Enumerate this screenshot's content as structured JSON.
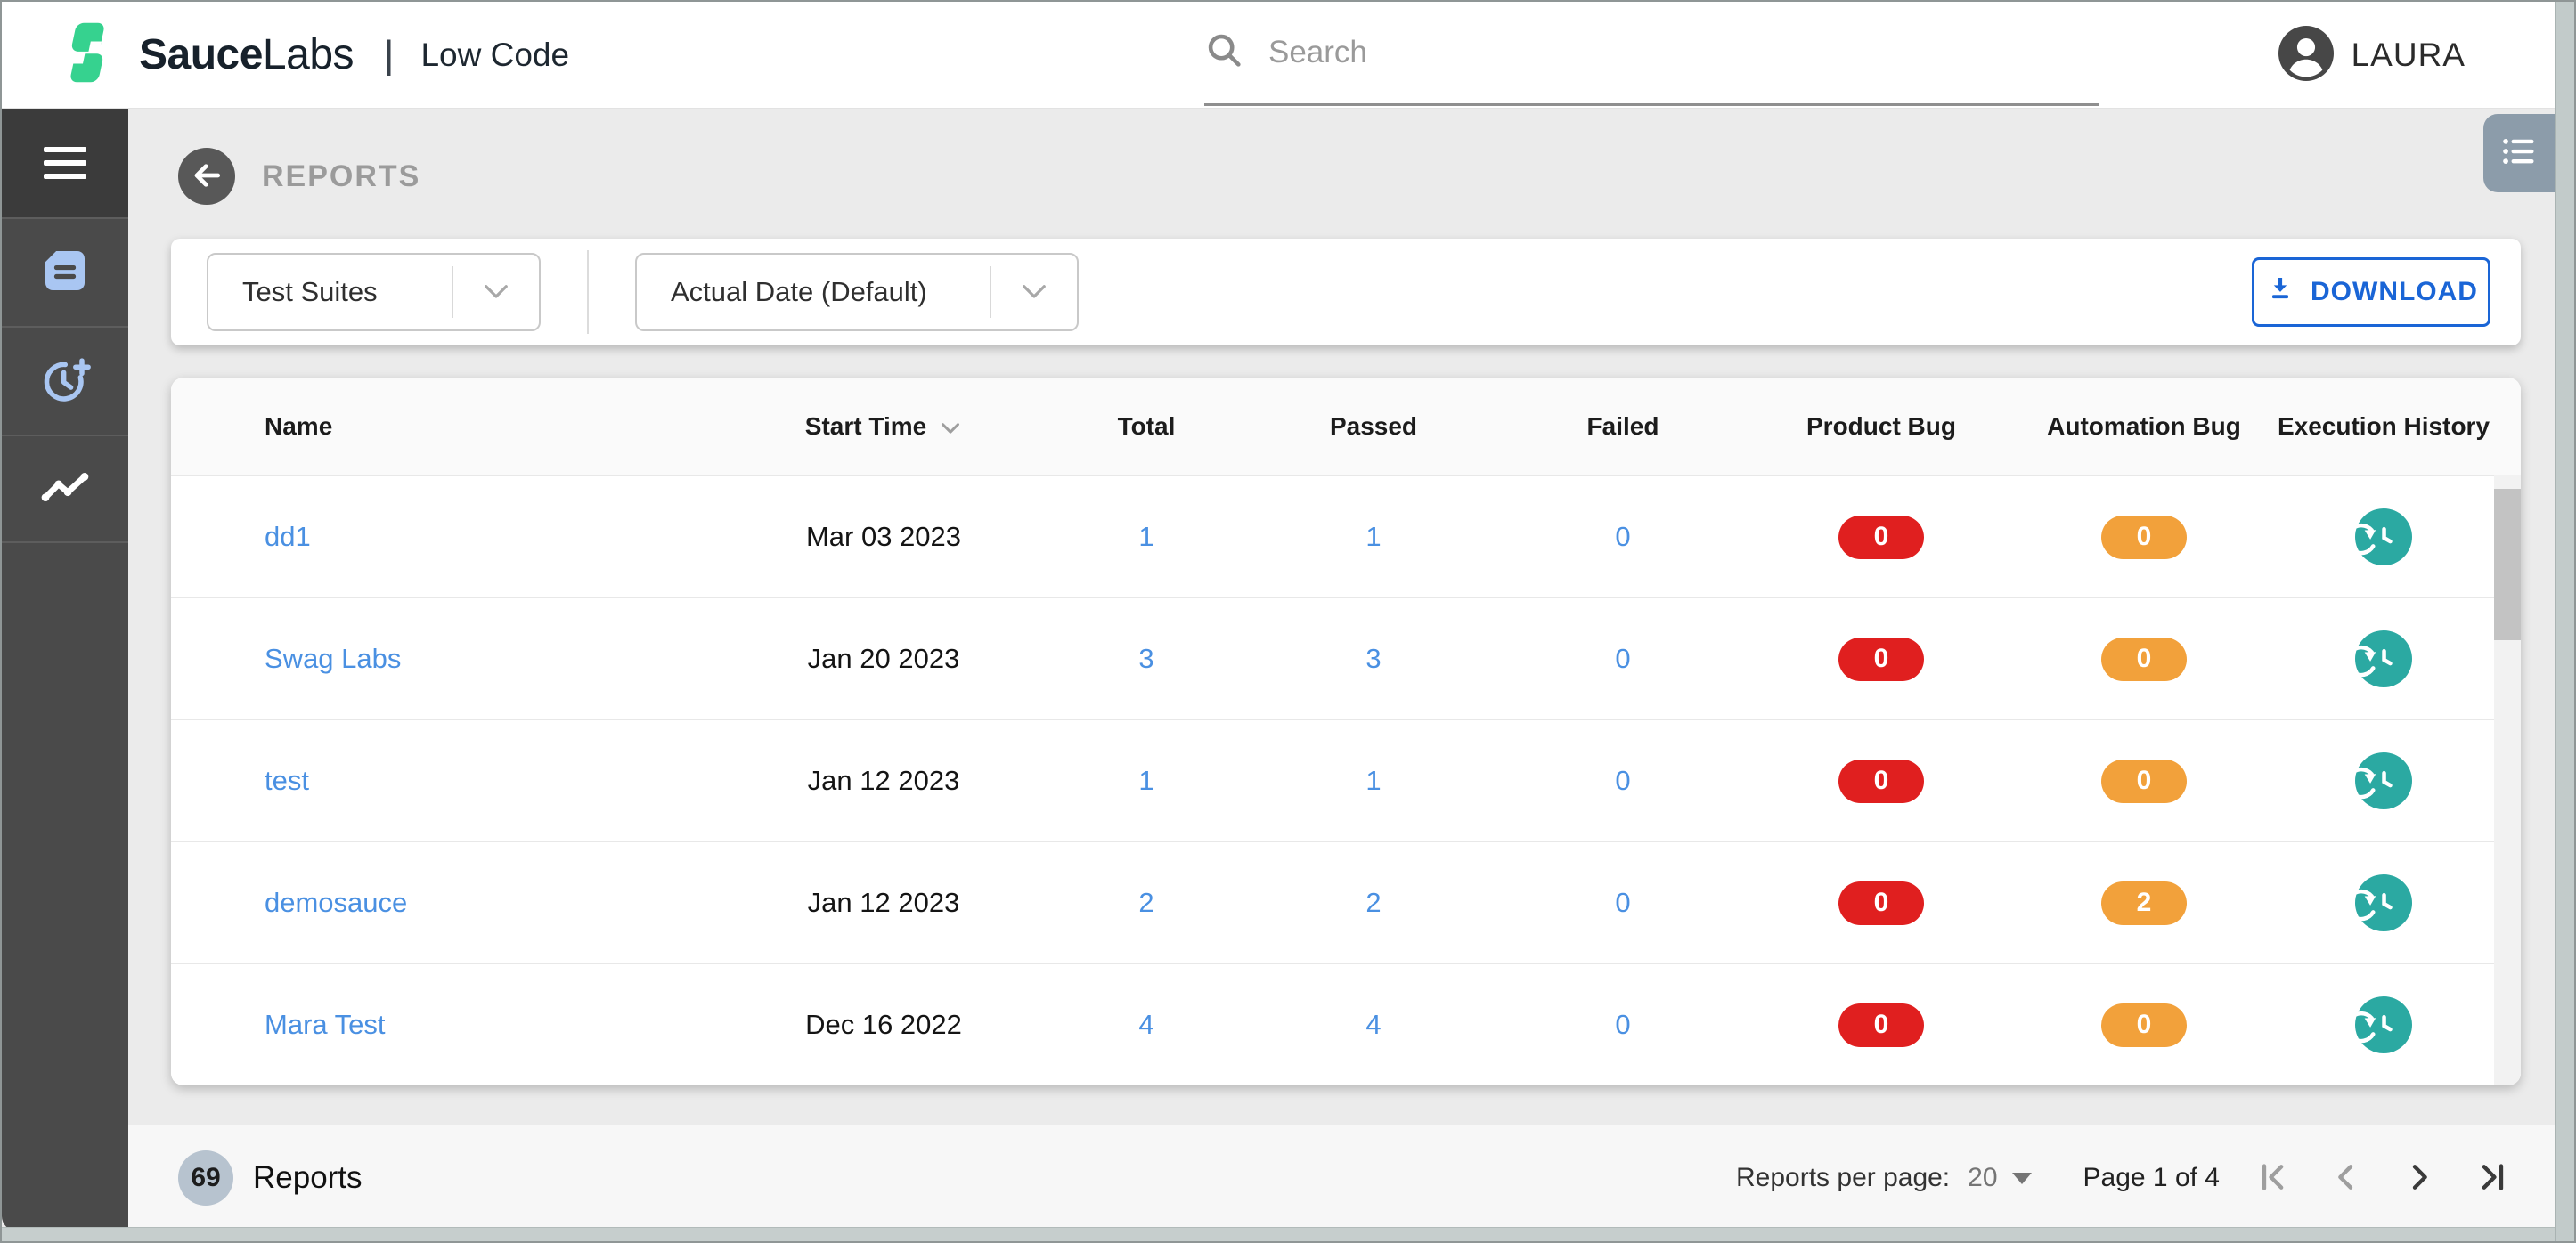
{
  "topbar": {
    "brand": {
      "word_bold": "Sauce",
      "word_light": "Labs",
      "separator": "|",
      "product": "Low Code"
    },
    "search": {
      "placeholder": "Search"
    },
    "user": {
      "name": "LAURA"
    }
  },
  "sidebar": {
    "items": [
      {
        "id": "menu",
        "icon": "hamburger-icon"
      },
      {
        "id": "documents",
        "icon": "document-icon"
      },
      {
        "id": "schedule",
        "icon": "clock-plus-icon"
      },
      {
        "id": "reports",
        "icon": "trend-line-icon",
        "active": true
      }
    ]
  },
  "page_header": {
    "title": "REPORTS"
  },
  "filter_bar": {
    "suite_filter": {
      "value": "Test Suites"
    },
    "date_filter": {
      "value": "Actual Date (Default)"
    },
    "download_button": "DOWNLOAD"
  },
  "table": {
    "columns": [
      "Name",
      "Start Time",
      "Total",
      "Passed",
      "Failed",
      "Product Bug",
      "Automation Bug",
      "Execution History"
    ],
    "rows": [
      {
        "name": "dd1",
        "start_time": "Mar 03 2023",
        "total": "1",
        "passed": "1",
        "failed": "0",
        "product_bug": "0",
        "automation_bug": "0"
      },
      {
        "name": "Swag Labs",
        "start_time": "Jan 20 2023",
        "total": "3",
        "passed": "3",
        "failed": "0",
        "product_bug": "0",
        "automation_bug": "0"
      },
      {
        "name": "test",
        "start_time": "Jan 12 2023",
        "total": "1",
        "passed": "1",
        "failed": "0",
        "product_bug": "0",
        "automation_bug": "0"
      },
      {
        "name": "demosauce",
        "start_time": "Jan 12 2023",
        "total": "2",
        "passed": "2",
        "failed": "0",
        "product_bug": "0",
        "automation_bug": "2"
      },
      {
        "name": "Mara Test",
        "start_time": "Dec 16 2022",
        "total": "4",
        "passed": "4",
        "failed": "0",
        "product_bug": "0",
        "automation_bug": "0"
      }
    ]
  },
  "footer": {
    "count": "69",
    "count_label": "Reports",
    "per_page_label": "Reports per page:",
    "per_page_value": "20",
    "page_status": "Page 1 of 4"
  },
  "colors": {
    "brand_green": "#36d28f",
    "link_blue": "#4a90e2",
    "download_blue": "#1a65d6",
    "product_bug_red": "#e01f1f",
    "automation_bug_orange": "#f2a13b",
    "history_teal": "#2ba9a2",
    "sidebar_gray": "#4a4a4a",
    "count_badge_gray": "#b7c3cf",
    "list_tab_slate": "#8c9caa"
  }
}
